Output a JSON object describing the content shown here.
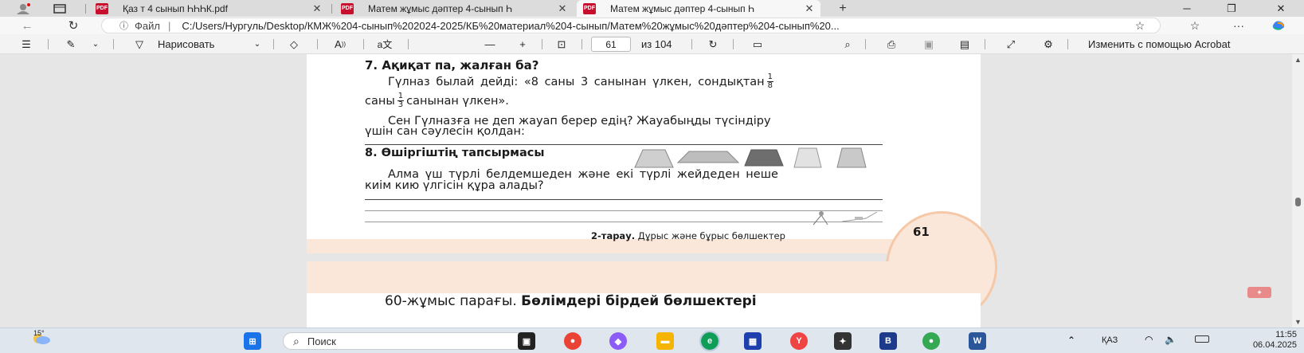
{
  "tabs": [
    {
      "label": "Қаз т 4 сынып ҺҺҺК.pdf",
      "active": false
    },
    {
      "label": "Матем жұмыс дәптер 4-сынып Һ",
      "active": false
    },
    {
      "label": "Матем жұмыс дәптер 4-сынып Һ",
      "active": true
    }
  ],
  "address": {
    "info_label": "ⓘ",
    "file_label": "Файл",
    "separator": "|",
    "url": "C:/Users/Нургуль/Desktop/КМЖ%204-сынып%202024-2025/КБ%20материал%204-сынып/Матем%20жұмыс%20дәптер%204-сынып%20..."
  },
  "pdf_toolbar": {
    "draw_label": "Нарисовать",
    "page_current": "61",
    "page_total": "из 104",
    "acrobat_label": "Изменить с помощью Acrobat"
  },
  "document": {
    "q7_title": "7. Ақиқат па, жалған ба?",
    "q7_line1_pre": "Гүлназ былай дейді: «8 саны 3 санынан үлкен, сондықтан",
    "q7_frac1_num": "1",
    "q7_frac1_den": "8",
    "q7_line2_pre": "саны",
    "q7_frac2_num": "1",
    "q7_frac2_den": "3",
    "q7_line2_post": "санынан үлкен».",
    "q7_line3": "Сен Гүлназға не деп жауап берер едің? Жауабыңды түсіндіру",
    "q7_line4": "үшін сан сәулесін қолдан:",
    "q8_title": "8. Өшіргіштің тапсырмасы",
    "q8_line1": "Алма үш түрлі белдемшеден және екі түрлі жейдеден неше",
    "q8_line2": "киім кию үлгісін құра алады?",
    "footer_bold": "2-тарау.",
    "footer_text": "Дұрыс және бұрыс бөлшектер",
    "page_number": "61",
    "next_page_pre": "60-жұмыс парағы.",
    "next_page_bold": "Бөлімдері бірдей бөлшектері"
  },
  "taskbar": {
    "weather": "15°",
    "search_placeholder": "Поиск",
    "lang": "ҚАЗ",
    "time": "11:55",
    "date": "06.04.2025"
  }
}
